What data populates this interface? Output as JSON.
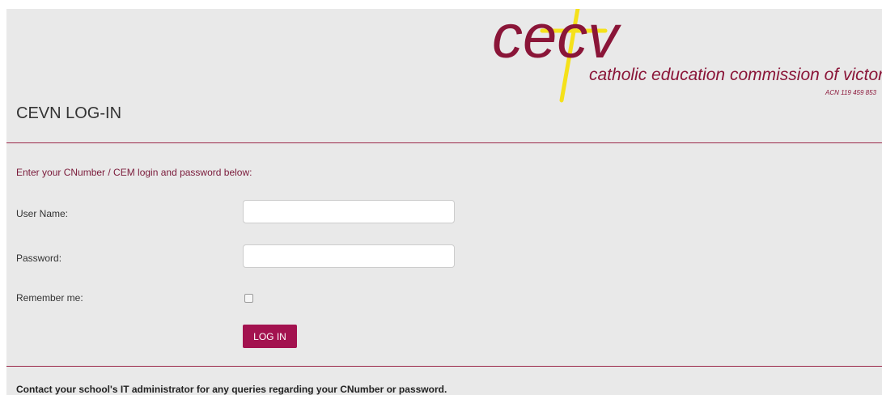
{
  "logo": {
    "wordmark": "cecv",
    "subtitle": "catholic education commission of victoria ltd",
    "acn": "ACN 119 459 853",
    "colors": {
      "brand": "#8a1538",
      "cross": "#f5e11a"
    }
  },
  "page_title": "CEVN LOG-IN",
  "intro_text": "Enter your CNumber / CEM login and password below:",
  "form": {
    "username_label": "User Name:",
    "username_value": "",
    "password_label": "Password:",
    "password_value": "",
    "remember_label": "Remember me:",
    "remember_checked": false,
    "login_button": "LOG IN"
  },
  "footer_note": "Contact your school's IT administrator for any queries regarding your CNumber or password.",
  "colors": {
    "page_bg": "#e9e9e9",
    "accent": "#a3124f",
    "divider": "#9c2a4a",
    "intro_text": "#7a1a3a"
  }
}
